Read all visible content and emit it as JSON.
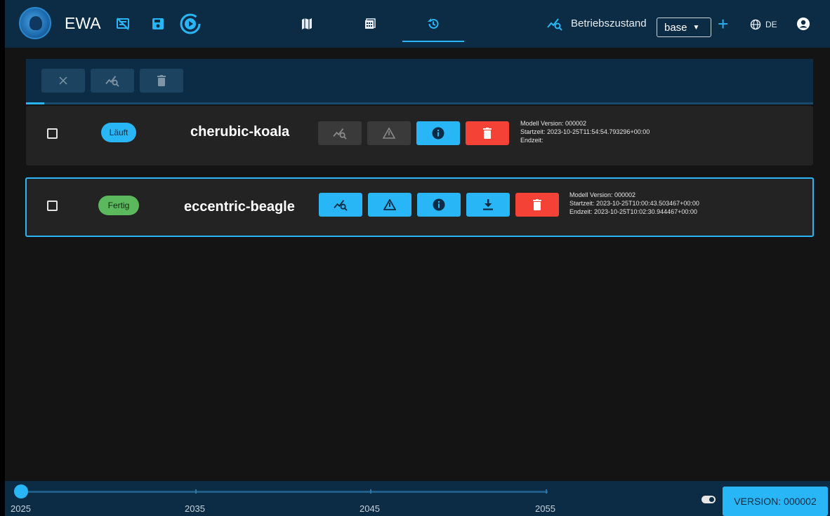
{
  "header": {
    "app_title": "EWA",
    "left_icons": [
      "notes-off-icon",
      "save-icon",
      "play-circle-icon"
    ],
    "tabs": [
      {
        "name": "map-tab",
        "icon": "map-icon",
        "active": false
      },
      {
        "name": "calculator-tab",
        "icon": "calculator-icon",
        "active": false
      },
      {
        "name": "history-tab",
        "icon": "history-icon",
        "active": true
      }
    ],
    "operating_state_label": "Betriebszustand",
    "operating_state_value": "base",
    "add_label": "+",
    "language": "DE"
  },
  "toolbar": {
    "buttons": [
      "close-icon",
      "chart-search-icon",
      "trash-icon"
    ]
  },
  "runs": [
    {
      "status": "Läuft",
      "name": "cherubic-koala",
      "meta": {
        "model_version": "Modell Version: 000002",
        "start": "Startzeit: 2023-10-25T11:54:54.793296+00:00",
        "end": "Endzeit:"
      }
    },
    {
      "status": "Fertig",
      "name": "eccentric-beagle",
      "meta": {
        "model_version": "Modell Version: 000002",
        "start": "Startzeit: 2023-10-25T10:00:43.503467+00:00",
        "end": "Endzeit: 2023-10-25T10:02:30.944467+00:00"
      }
    }
  ],
  "timeline": {
    "years": [
      "2025",
      "2035",
      "2045",
      "2055"
    ],
    "selected_year": "2025"
  },
  "footer": {
    "version_label": "VERSION: 000002"
  },
  "colors": {
    "accent": "#29b6f6",
    "header_bg": "#0c2b45",
    "danger": "#f44336",
    "success": "#5cb85c"
  }
}
